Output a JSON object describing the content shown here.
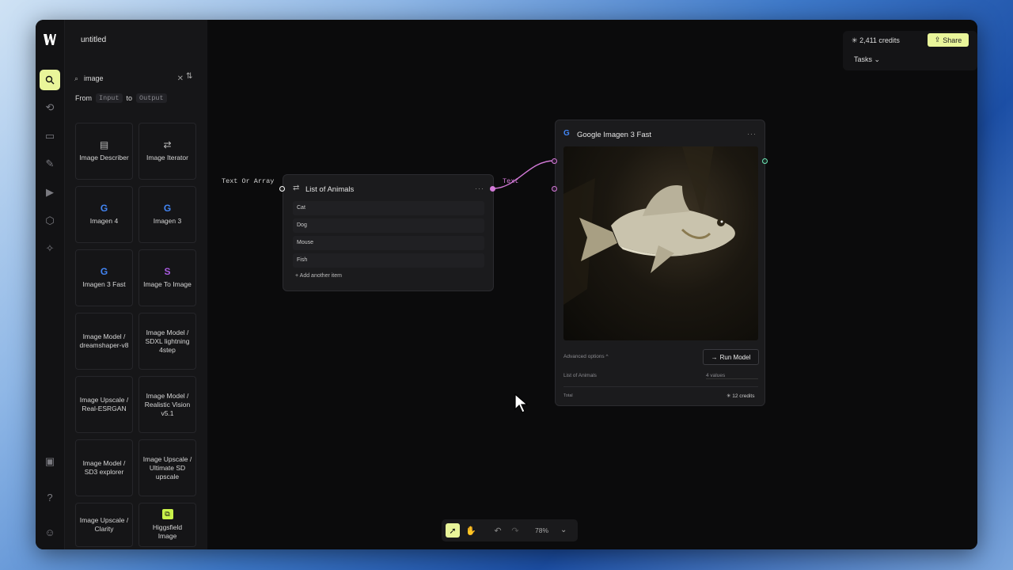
{
  "app": {
    "title": "untitled"
  },
  "rail": {
    "icons": [
      "search-icon",
      "history-icon",
      "briefcase-icon",
      "edit-icon",
      "video-icon",
      "cube-icon",
      "sparkle-icon",
      "image-icon",
      "help-icon",
      "discord-icon"
    ]
  },
  "search": {
    "value": "image",
    "clear_icon": "close-icon",
    "sort_icon": "sort-icon"
  },
  "filter": {
    "from_label": "From",
    "input_chip": "Input",
    "to_label": "to",
    "output_chip": "Output"
  },
  "models": [
    {
      "label": "Image Describer",
      "icon": "▤"
    },
    {
      "label": "Image Iterator",
      "icon": "⇄"
    },
    {
      "label": "Imagen 4",
      "icon": "G"
    },
    {
      "label": "Imagen 3",
      "icon": "G"
    },
    {
      "label": "Imagen 3 Fast",
      "icon": "G"
    },
    {
      "label": "Image To Image",
      "icon": "S"
    },
    {
      "label": "Image Model / dreamshaper-v8",
      "icon": ""
    },
    {
      "label": "Image Model / SDXL lightning 4step",
      "icon": ""
    },
    {
      "label": "Image Upscale / Real-ESRGAN",
      "icon": ""
    },
    {
      "label": "Image Model / Realistic Vision v5.1",
      "icon": ""
    },
    {
      "label": "Image Model / SD3 explorer",
      "icon": ""
    },
    {
      "label": "Image Upscale / Ultimate SD upscale",
      "icon": ""
    },
    {
      "label": "Image Upscale / Clarity",
      "icon": ""
    },
    {
      "label": "Higgsfield Image",
      "icon": "hf"
    }
  ],
  "header": {
    "credits": "2,411 credits",
    "share_label": "Share",
    "tasks_label": "Tasks"
  },
  "list_node": {
    "input_label": "Text Or Array",
    "title": "List of Animals",
    "items": [
      "Cat",
      "Dog",
      "Mouse",
      "Fish"
    ],
    "add_label": "Add another item",
    "output_label": "Text"
  },
  "model_node": {
    "title": "Google Imagen 3 Fast",
    "advanced": "Advanced options ^",
    "run_label": "Run Model",
    "input_name": "List of Animals",
    "input_value": "4 values",
    "total_label": "Total",
    "total_value": "12 credits"
  },
  "toolbar": {
    "zoom": "78%"
  },
  "colors": {
    "accent": "#e9f59a",
    "edge": "#d37ad8",
    "port_out": "#6ee7b7"
  }
}
